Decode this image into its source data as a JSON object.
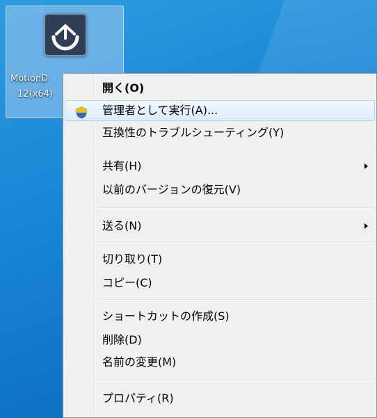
{
  "desktop": {
    "icon": {
      "name": "app-icon",
      "label_line1": "MotionD",
      "label_line2": "12(x64)"
    }
  },
  "context_menu": {
    "items": [
      {
        "label": "開く(O)",
        "bold": true
      },
      {
        "label": "管理者として実行(A)...",
        "icon": "uac-shield-icon",
        "highlighted": true
      },
      {
        "label": "互換性のトラブルシューティング(Y)"
      },
      {
        "label": "共有(H)",
        "submenu": true
      },
      {
        "label": "以前のバージョンの復元(V)"
      },
      {
        "label": "送る(N)",
        "submenu": true
      },
      {
        "label": "切り取り(T)"
      },
      {
        "label": "コピー(C)"
      },
      {
        "label": "ショートカットの作成(S)"
      },
      {
        "label": "削除(D)"
      },
      {
        "label": "名前の変更(M)"
      },
      {
        "label": "プロパティ(R)"
      }
    ]
  },
  "colors": {
    "desktop_bg": "#1a86d6",
    "menu_bg": "#f0f0f0",
    "highlight_border": "#a8d8f6"
  }
}
